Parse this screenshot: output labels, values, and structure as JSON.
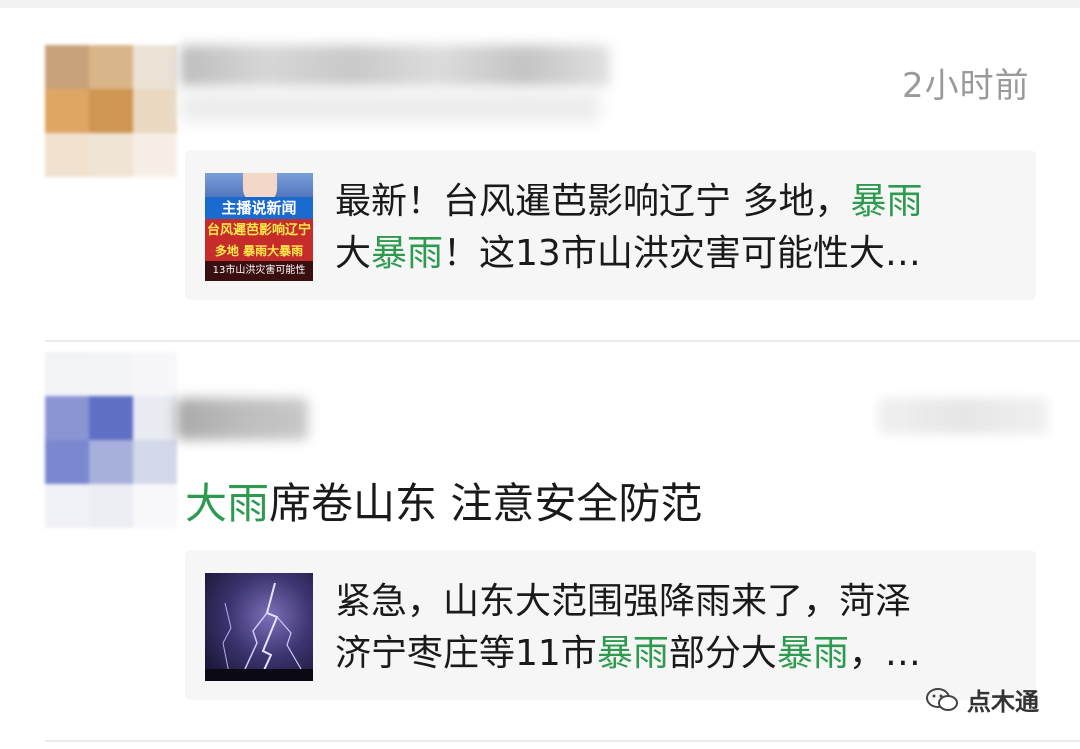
{
  "feed": {
    "items": [
      {
        "timestamp": "2小时前",
        "card": {
          "thumb_labels": [
            "主播说新闻",
            "台风遲芭影响辽宁",
            "多地 暴雨大暴雨",
            "13市山洪灾害可能性"
          ],
          "line1_a": "最新！台风暹芭影响辽宁 多地，",
          "line1_hl": "暴雨",
          "line2_a": "大",
          "line2_hl": "暴雨",
          "line2_b": "！这13市山洪灾害可能性大…"
        }
      },
      {
        "title_hl": "大雨",
        "title_rest": "席卷山东 注意安全防范",
        "card": {
          "line1": "紧急，山东大范围强降雨来了，菏泽",
          "line2_a": "济宁枣庄等11市",
          "line2_hl1": "暴雨",
          "line2_b": "部分大",
          "line2_hl2": "暴雨",
          "line2_c": "，…"
        }
      }
    ]
  },
  "watermark": {
    "text": "点木通",
    "icon": "wechat-official-account-icon"
  },
  "colors": {
    "highlight": "#2d9a4f",
    "timestamp": "#9a9a9a",
    "card_bg": "#f6f6f6"
  }
}
